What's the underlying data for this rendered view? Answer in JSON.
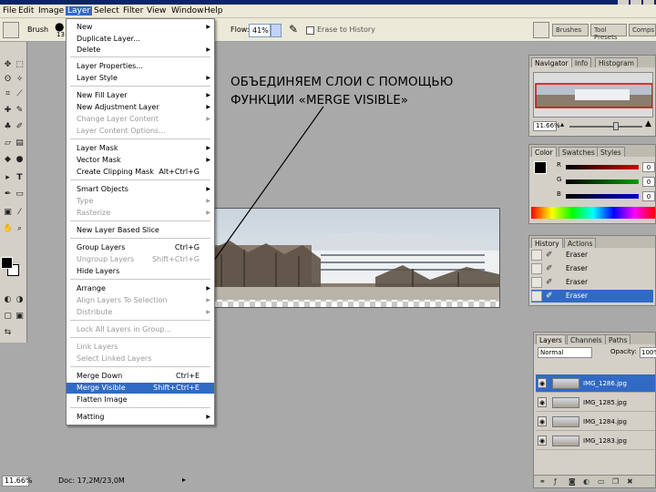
{
  "menubar": [
    "File",
    "Edit",
    "Image",
    "Layer",
    "Select",
    "Filter",
    "View",
    "Window",
    "Help"
  ],
  "options": {
    "tool": "Brush",
    "brush_size": "13",
    "flow_label": "Flow:",
    "flow_value": "41%",
    "history_label": "Erase to History",
    "palette_tabs": [
      "Brushes",
      "Tool Presets",
      "Comps"
    ]
  },
  "annotation": {
    "line1": "ОБЪЕДИНЯЕМ СЛОИ С ПОМОЩЬЮ",
    "line2": "ФУНКЦИИ «MERGE VISIBLE»"
  },
  "layer_menu": {
    "items": [
      {
        "label": "New",
        "sc": "",
        "sub": true,
        "disabled": false
      },
      {
        "label": "Duplicate Layer...",
        "sc": "",
        "sub": false,
        "disabled": false
      },
      {
        "label": "Delete",
        "sc": "",
        "sub": true,
        "disabled": false
      },
      {
        "label": "Layer Properties...",
        "sc": "",
        "sub": false,
        "disabled": false
      },
      {
        "label": "Layer Style",
        "sc": "",
        "sub": true,
        "disabled": false
      },
      {
        "label": "New Fill Layer",
        "sc": "",
        "sub": true,
        "disabled": false
      },
      {
        "label": "New Adjustment Layer",
        "sc": "",
        "sub": true,
        "disabled": false
      },
      {
        "label": "Change Layer Content",
        "sc": "",
        "sub": true,
        "disabled": true
      },
      {
        "label": "Layer Content Options...",
        "sc": "",
        "sub": false,
        "disabled": true
      },
      {
        "label": "Layer Mask",
        "sc": "",
        "sub": true,
        "disabled": false
      },
      {
        "label": "Vector Mask",
        "sc": "",
        "sub": true,
        "disabled": false
      },
      {
        "label": "Create Clipping Mask",
        "sc": "Alt+Ctrl+G",
        "sub": false,
        "disabled": false
      },
      {
        "label": "Smart Objects",
        "sc": "",
        "sub": true,
        "disabled": false
      },
      {
        "label": "Type",
        "sc": "",
        "sub": true,
        "disabled": true
      },
      {
        "label": "Rasterize",
        "sc": "",
        "sub": true,
        "disabled": true
      },
      {
        "label": "New Layer Based Slice",
        "sc": "",
        "sub": false,
        "disabled": false
      },
      {
        "label": "Group Layers",
        "sc": "Ctrl+G",
        "sub": false,
        "disabled": false
      },
      {
        "label": "Ungroup Layers",
        "sc": "Shift+Ctrl+G",
        "sub": false,
        "disabled": true
      },
      {
        "label": "Hide Layers",
        "sc": "",
        "sub": false,
        "disabled": false
      },
      {
        "label": "Arrange",
        "sc": "",
        "sub": true,
        "disabled": false
      },
      {
        "label": "Align Layers To Selection",
        "sc": "",
        "sub": true,
        "disabled": true
      },
      {
        "label": "Distribute",
        "sc": "",
        "sub": true,
        "disabled": true
      },
      {
        "label": "Lock All Layers in Group...",
        "sc": "",
        "sub": false,
        "disabled": true
      },
      {
        "label": "Link Layers",
        "sc": "",
        "sub": false,
        "disabled": true
      },
      {
        "label": "Select Linked Layers",
        "sc": "",
        "sub": false,
        "disabled": true
      },
      {
        "label": "Merge Down",
        "sc": "Ctrl+E",
        "sub": false,
        "disabled": false
      },
      {
        "label": "Merge Visible",
        "sc": "Shift+Ctrl+E",
        "sub": false,
        "disabled": false,
        "highlighted": true
      },
      {
        "label": "Flatten Image",
        "sc": "",
        "sub": false,
        "disabled": false
      },
      {
        "label": "Matting",
        "sc": "",
        "sub": true,
        "disabled": false
      }
    ]
  },
  "navigator": {
    "tabs": [
      "Navigator",
      "Info",
      "Histogram"
    ],
    "zoom": "11.66%"
  },
  "color": {
    "tabs": [
      "Color",
      "Swatches",
      "Styles"
    ],
    "channels": [
      {
        "label": "R",
        "value": "0",
        "color": "#d40000"
      },
      {
        "label": "G",
        "value": "0",
        "color": "#00a000"
      },
      {
        "label": "B",
        "value": "0",
        "color": "#0000c8"
      }
    ]
  },
  "history": {
    "tabs": [
      "History",
      "Actions"
    ],
    "states": [
      "Eraser",
      "Eraser",
      "Eraser",
      "Eraser"
    ]
  },
  "layers": {
    "tabs": [
      "Layers",
      "Channels",
      "Paths"
    ],
    "mode": "Normal",
    "opacity_label": "Opacity:",
    "opacity": "100%",
    "rows": [
      "IMG_1286.jpg",
      "IMG_1285.jpg",
      "IMG_1284.jpg",
      "IMG_1283.jpg"
    ]
  },
  "status": {
    "zoom": "11.66%",
    "doc": "Doc: 17,2M/23,0M"
  }
}
